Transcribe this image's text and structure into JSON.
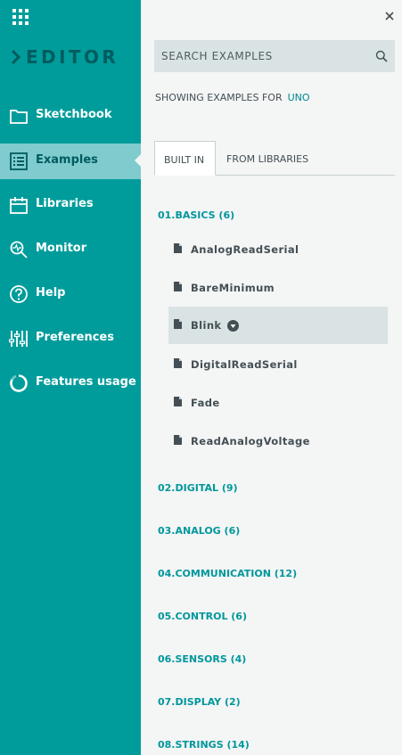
{
  "brand": {
    "title": "EDITOR"
  },
  "sidebar": {
    "items": [
      {
        "label": "Sketchbook",
        "icon": "folder-icon",
        "active": false
      },
      {
        "label": "Examples",
        "icon": "list-icon",
        "active": true
      },
      {
        "label": "Libraries",
        "icon": "libraries-icon",
        "active": false
      },
      {
        "label": "Monitor",
        "icon": "monitor-icon",
        "active": false
      },
      {
        "label": "Help",
        "icon": "help-icon",
        "active": false
      },
      {
        "label": "Preferences",
        "icon": "sliders-icon",
        "active": false
      },
      {
        "label": "Features usage",
        "icon": "usage-icon",
        "active": false
      }
    ]
  },
  "search": {
    "placeholder": "SEARCH EXAMPLES"
  },
  "showing": {
    "prefix": "SHOWING EXAMPLES FOR",
    "board": "UNO"
  },
  "tabs": [
    {
      "label": "BUILT IN",
      "active": true
    },
    {
      "label": "FROM LIBRARIES",
      "active": false
    }
  ],
  "basics": {
    "label": "01.BASICS (6)",
    "examples": [
      {
        "label": "AnalogReadSerial"
      },
      {
        "label": "BareMinimum"
      },
      {
        "label": "Blink",
        "selected": true
      },
      {
        "label": "DigitalReadSerial"
      },
      {
        "label": "Fade"
      },
      {
        "label": "ReadAnalogVoltage"
      }
    ]
  },
  "folders": [
    {
      "label": "02.DIGITAL (9)"
    },
    {
      "label": "03.ANALOG (6)"
    },
    {
      "label": "04.COMMUNICATION (12)"
    },
    {
      "label": "05.CONTROL (6)"
    },
    {
      "label": "06.SENSORS (4)"
    },
    {
      "label": "07.DISPLAY (2)"
    },
    {
      "label": "08.STRINGS (14)"
    }
  ],
  "colors": {
    "sidebar": "#009c9b",
    "active": "#7fcbcd",
    "accent": "#00979c",
    "brand": "#005c5f"
  }
}
